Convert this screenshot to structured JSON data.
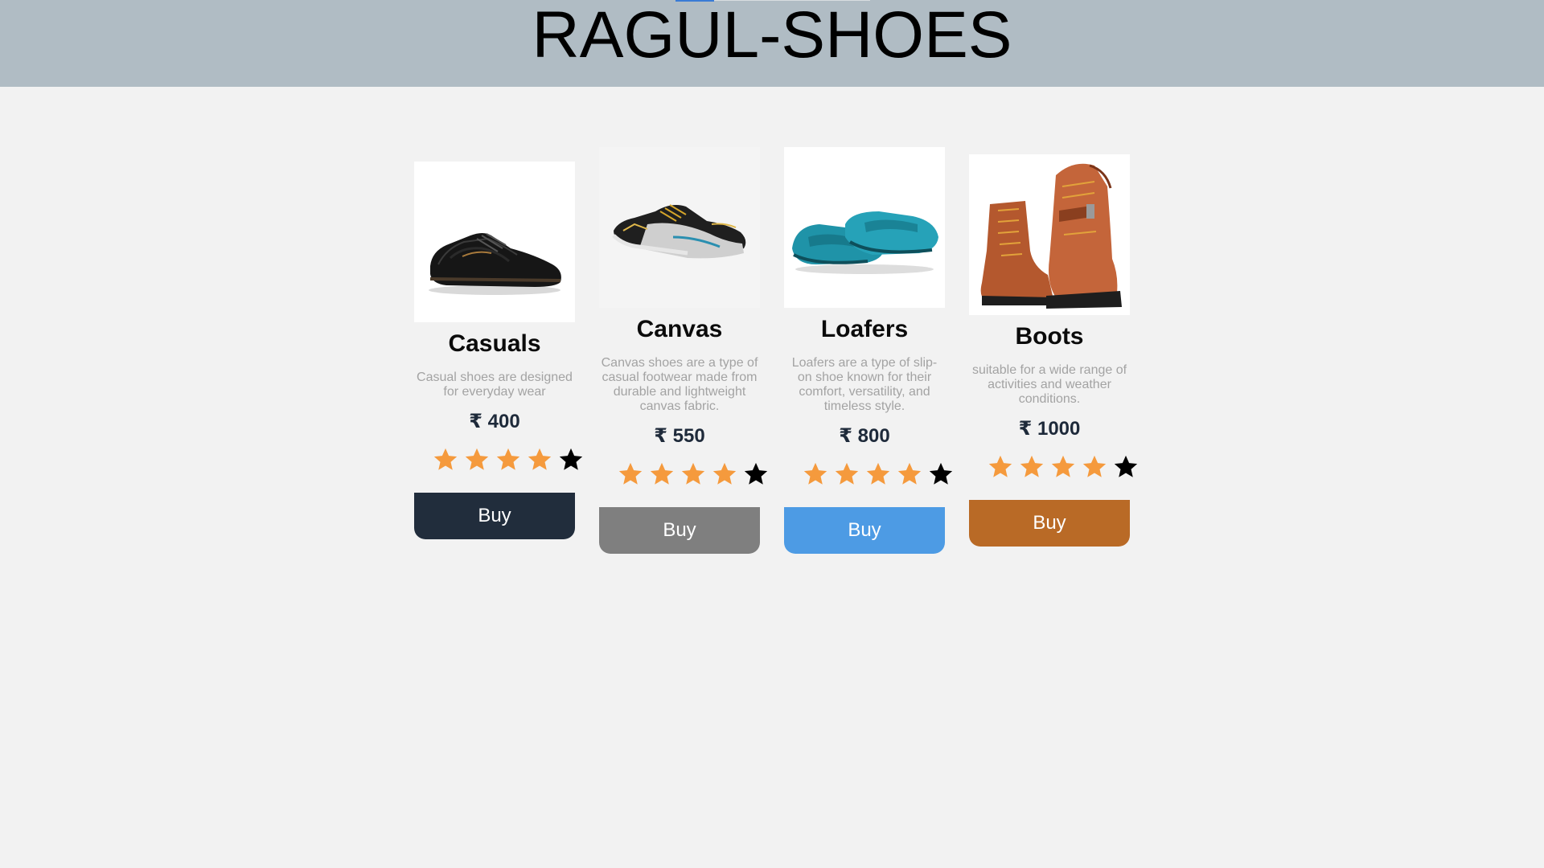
{
  "header": {
    "title": "RAGUL-SHOES"
  },
  "currency_symbol": "₹",
  "products": [
    {
      "name": "Casuals",
      "description": "Casual shoes are designed for everyday wear",
      "price": "₹ 400",
      "rating": 4,
      "rating_max": 5,
      "buy_label": "Buy",
      "button_color": "#212d3c",
      "image": "black-oxford-shoe"
    },
    {
      "name": "Canvas",
      "description": "Canvas shoes are a type of casual footwear made from durable and lightweight canvas fabric.",
      "price": "₹ 550",
      "rating": 4,
      "rating_max": 5,
      "buy_label": "Buy",
      "button_color": "#7f7f7f",
      "image": "black-running-sneaker"
    },
    {
      "name": "Loafers",
      "description": "Loafers are a type of slip-on shoe known for their comfort, versatility, and timeless style.",
      "price": "₹ 800",
      "rating": 4,
      "rating_max": 5,
      "buy_label": "Buy",
      "button_color": "#4d9be4",
      "image": "teal-suede-loafer"
    },
    {
      "name": "Boots",
      "description": "suitable for a wide range of activities and weather conditions.",
      "price": "₹ 1000",
      "rating": 4,
      "rating_max": 5,
      "buy_label": "Buy",
      "button_color": "#b96a26",
      "image": "tan-leather-boot"
    }
  ],
  "colors": {
    "header_bg": "#b0bcc4",
    "page_bg": "#f2f2f2",
    "star_filled": "#f59a3d",
    "star_empty": "#000000",
    "description_text": "#a3a3a3",
    "price_text": "#1e2a3a"
  }
}
